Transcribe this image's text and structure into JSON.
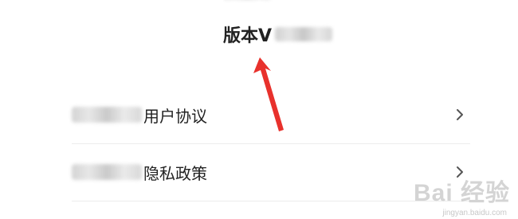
{
  "header": {
    "version_label": "版本V"
  },
  "menu": {
    "items": [
      {
        "label": "用户协议"
      },
      {
        "label": "隐私政策"
      }
    ]
  },
  "watermark": {
    "main": "Bai 经验",
    "sub": "jingyan.baidu.com"
  },
  "colors": {
    "annotation_arrow": "#e8312c",
    "divider": "#ececec"
  },
  "icons": {
    "chevron": "chevron-right-icon",
    "arrow": "red-arrow-annotation"
  }
}
